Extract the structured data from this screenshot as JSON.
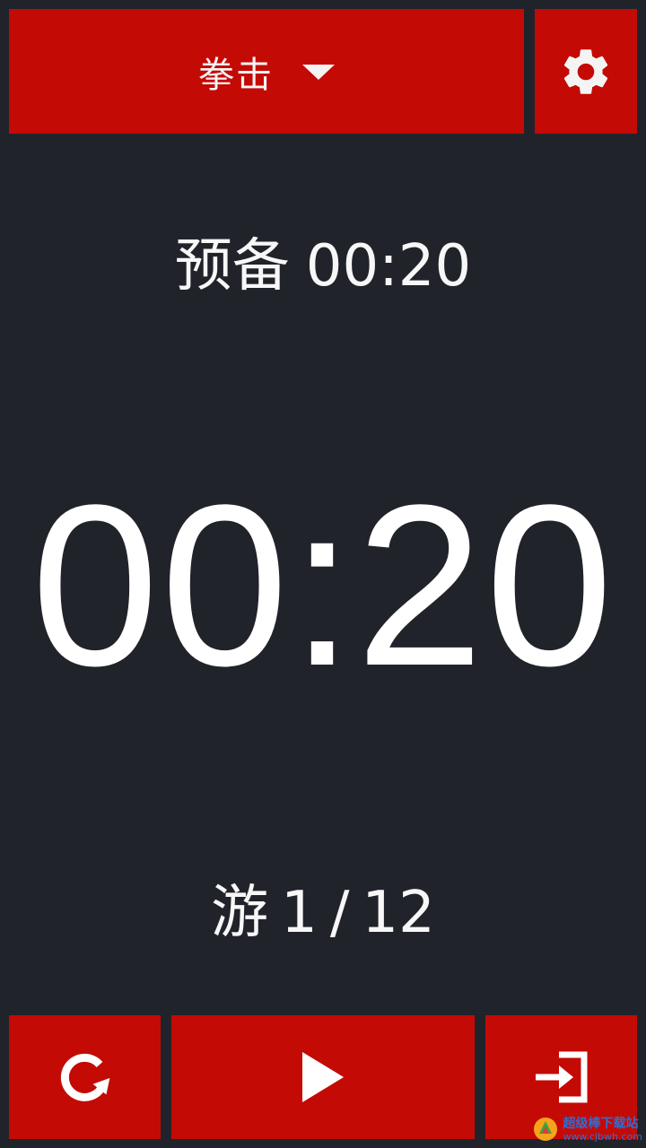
{
  "header": {
    "mode_label": "拳击",
    "mode_caret_icon": "caret-down-icon",
    "settings_icon": "gear-icon"
  },
  "phase": {
    "label": "预备",
    "time": "00:20"
  },
  "timer": {
    "display": "00:20"
  },
  "round": {
    "label": "游",
    "current": "1",
    "separator": "/",
    "total": "12"
  },
  "controls": {
    "reset_icon": "reset-icon",
    "play_icon": "play-icon",
    "exit_icon": "exit-icon"
  },
  "watermark": {
    "title": "超级棒下载站",
    "url": "www.cjbwh.com"
  },
  "colors": {
    "background": "#21232b",
    "accent": "#c40a05",
    "text": "#ffffff"
  }
}
